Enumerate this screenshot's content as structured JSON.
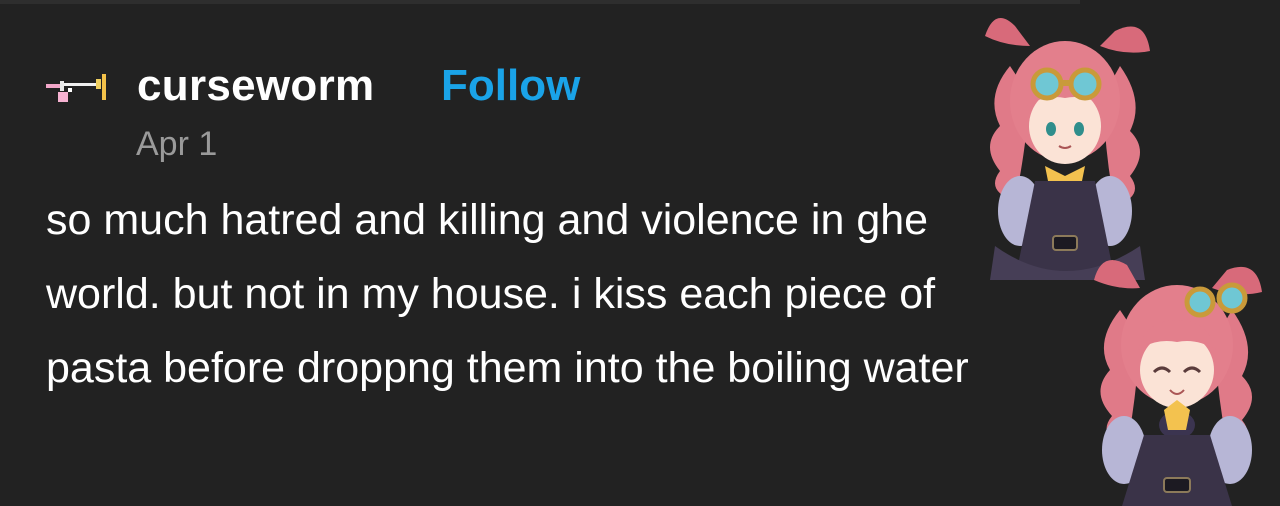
{
  "post": {
    "username": "curseworm",
    "follow_label": "Follow",
    "date": "Apr 1",
    "body": "so much hatred and killing and violence in ghe world. but not in my house. i kiss each piece of pasta before droppng them into the boiling water"
  },
  "stickers": [
    {
      "name": "anime-girl-goggles-sticker"
    },
    {
      "name": "anime-girl-smiling-sticker"
    }
  ],
  "colors": {
    "background": "#222222",
    "follow_link": "#1aa3e8",
    "date_text": "#9a9a9a",
    "body_text": "#ffffff"
  }
}
